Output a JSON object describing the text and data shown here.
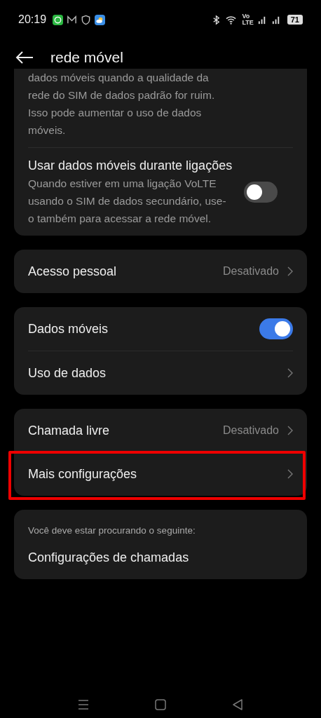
{
  "status_bar": {
    "time": "20:19",
    "volte": "Vo",
    "lte": "LTE",
    "battery": "71"
  },
  "header": {
    "title": "rede móvel"
  },
  "cards": [
    {
      "items": [
        {
          "kind": "toggle",
          "description": "dados móveis quando a qualidade da rede do SIM de dados padrão for ruim. Isso pode aumentar o uso de dados móveis."
        },
        {
          "kind": "toggle",
          "title": "Usar dados móveis durante ligações",
          "description": "Quando estiver em uma ligação VoLTE usando o SIM de dados secundário, use-o também para acessar a rede móvel.",
          "on": false
        }
      ]
    },
    {
      "items": [
        {
          "kind": "link",
          "title": "Acesso pessoal",
          "value": "Desativado"
        }
      ]
    },
    {
      "items": [
        {
          "kind": "toggle",
          "title": "Dados móveis",
          "on": true
        },
        {
          "kind": "link",
          "title": "Uso de dados"
        }
      ]
    },
    {
      "items": [
        {
          "kind": "link",
          "title": "Chamada livre",
          "value": "Desativado"
        },
        {
          "kind": "link",
          "title": "Mais configurações",
          "highlighted": true
        }
      ]
    },
    {
      "items": [
        {
          "kind": "note",
          "title": "Você deve estar procurando o seguinte:"
        },
        {
          "kind": "plain",
          "title": "Configurações de chamadas"
        }
      ]
    }
  ]
}
